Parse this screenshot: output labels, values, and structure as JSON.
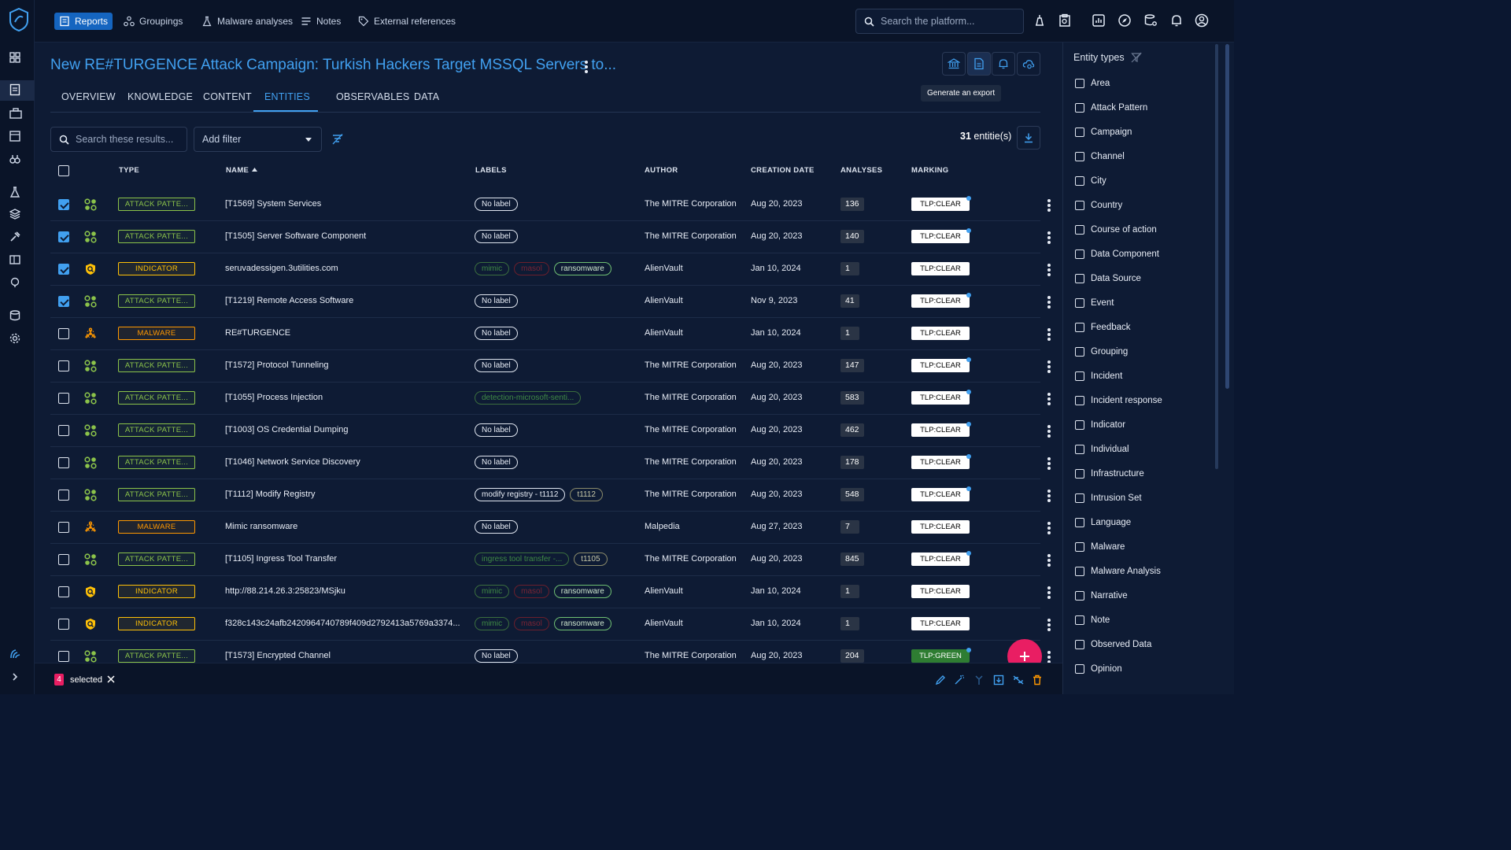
{
  "topnav": {
    "items": [
      {
        "label": "Reports",
        "active": true,
        "icon": "report-icon"
      },
      {
        "label": "Groupings",
        "icon": "groupings-icon"
      },
      {
        "label": "Malware analyses",
        "icon": "malware-analysis-icon"
      },
      {
        "label": "Notes",
        "icon": "notes-icon"
      },
      {
        "label": "External references",
        "icon": "tag-icon"
      }
    ],
    "search_placeholder": "Search the platform..."
  },
  "page": {
    "title": "New RE#TURGENCE Attack Campaign: Turkish Hackers Target MSSQL Servers to...",
    "tooltip": "Generate an export",
    "tabs": [
      "OVERVIEW",
      "KNOWLEDGE",
      "CONTENT",
      "ENTITIES",
      "OBSERVABLES",
      "DATA"
    ],
    "active_tab": "ENTITIES"
  },
  "toolbar": {
    "search_placeholder": "Search these results...",
    "filter_label": "Add filter",
    "count_number": "31",
    "count_suffix": " entitie(s)"
  },
  "table": {
    "headers": {
      "type": "TYPE",
      "name": "NAME",
      "labels": "LABELS",
      "author": "AUTHOR",
      "creation_date": "CREATION DATE",
      "analyses": "ANALYSES",
      "marking": "MARKING"
    },
    "sort": {
      "column": "NAME",
      "direction": "ascending"
    },
    "rows": [
      {
        "checked": true,
        "type": "ATTACK PATTE...",
        "kind": "ap",
        "name": "[T1569] System Services",
        "labels": [
          {
            "text": "No label",
            "style": "nolab"
          }
        ],
        "author": "The MITRE Corporation",
        "date": "Aug 20, 2023",
        "analyses": "136",
        "marking": "TLP:CLEAR",
        "dot": true
      },
      {
        "checked": true,
        "type": "ATTACK PATTE...",
        "kind": "ap",
        "name": "[T1505] Server Software Component",
        "labels": [
          {
            "text": "No label",
            "style": "nolab"
          }
        ],
        "author": "The MITRE Corporation",
        "date": "Aug 20, 2023",
        "analyses": "140",
        "marking": "TLP:CLEAR",
        "dot": true
      },
      {
        "checked": true,
        "type": "INDICATOR",
        "kind": "ind",
        "name": "seruvadessigen.3utilities.com",
        "labels": [
          {
            "text": "mimic",
            "style": "green"
          },
          {
            "text": "masol",
            "style": "red"
          },
          {
            "text": "ransomware",
            "style": "greenb"
          }
        ],
        "author": "AlienVault",
        "date": "Jan 10, 2024",
        "analyses": "1",
        "marking": "TLP:CLEAR",
        "dot": false
      },
      {
        "checked": true,
        "type": "ATTACK PATTE...",
        "kind": "ap",
        "name": "[T1219] Remote Access Software",
        "labels": [
          {
            "text": "No label",
            "style": "nolab"
          }
        ],
        "author": "AlienVault",
        "date": "Nov 9, 2023",
        "analyses": "41",
        "marking": "TLP:CLEAR",
        "dot": true
      },
      {
        "checked": false,
        "type": "MALWARE",
        "kind": "mal",
        "name": "RE#TURGENCE",
        "labels": [
          {
            "text": "No label",
            "style": "nolab"
          }
        ],
        "author": "AlienVault",
        "date": "Jan 10, 2024",
        "analyses": "1",
        "marking": "TLP:CLEAR",
        "dot": false
      },
      {
        "checked": false,
        "type": "ATTACK PATTE...",
        "kind": "ap",
        "name": "[T1572] Protocol Tunneling",
        "labels": [
          {
            "text": "No label",
            "style": "nolab"
          }
        ],
        "author": "The MITRE Corporation",
        "date": "Aug 20, 2023",
        "analyses": "147",
        "marking": "TLP:CLEAR",
        "dot": true
      },
      {
        "checked": false,
        "type": "ATTACK PATTE...",
        "kind": "ap",
        "name": "[T1055] Process Injection",
        "labels": [
          {
            "text": "detection-microsoft-senti...",
            "style": "green"
          }
        ],
        "author": "The MITRE Corporation",
        "date": "Aug 20, 2023",
        "analyses": "583",
        "marking": "TLP:CLEAR",
        "dot": true
      },
      {
        "checked": false,
        "type": "ATTACK PATTE...",
        "kind": "ap",
        "name": "[T1003] OS Credential Dumping",
        "labels": [
          {
            "text": "No label",
            "style": "nolab"
          }
        ],
        "author": "The MITRE Corporation",
        "date": "Aug 20, 2023",
        "analyses": "462",
        "marking": "TLP:CLEAR",
        "dot": true
      },
      {
        "checked": false,
        "type": "ATTACK PATTE...",
        "kind": "ap",
        "name": "[T1046] Network Service Discovery",
        "labels": [
          {
            "text": "No label",
            "style": "nolab"
          }
        ],
        "author": "The MITRE Corporation",
        "date": "Aug 20, 2023",
        "analyses": "178",
        "marking": "TLP:CLEAR",
        "dot": true
      },
      {
        "checked": false,
        "type": "ATTACK PATTE...",
        "kind": "ap",
        "name": "[T1112] Modify Registry",
        "labels": [
          {
            "text": "modify registry - t1112",
            "style": "nolab"
          },
          {
            "text": "t1112",
            "style": "olive"
          }
        ],
        "author": "The MITRE Corporation",
        "date": "Aug 20, 2023",
        "analyses": "548",
        "marking": "TLP:CLEAR",
        "dot": true
      },
      {
        "checked": false,
        "type": "MALWARE",
        "kind": "mal",
        "name": "Mimic ransomware",
        "labels": [
          {
            "text": "No label",
            "style": "nolab"
          }
        ],
        "author": "Malpedia",
        "date": "Aug 27, 2023",
        "analyses": "7",
        "marking": "TLP:CLEAR",
        "dot": false
      },
      {
        "checked": false,
        "type": "ATTACK PATTE...",
        "kind": "ap",
        "name": "[T1105] Ingress Tool Transfer",
        "labels": [
          {
            "text": "ingress tool transfer -...",
            "style": "green"
          },
          {
            "text": "t1105",
            "style": "olive"
          }
        ],
        "author": "The MITRE Corporation",
        "date": "Aug 20, 2023",
        "analyses": "845",
        "marking": "TLP:CLEAR",
        "dot": true
      },
      {
        "checked": false,
        "type": "INDICATOR",
        "kind": "ind",
        "name": "http://88.214.26.3:25823/MSjku",
        "labels": [
          {
            "text": "mimic",
            "style": "green"
          },
          {
            "text": "masol",
            "style": "red"
          },
          {
            "text": "ransomware",
            "style": "greenb"
          }
        ],
        "author": "AlienVault",
        "date": "Jan 10, 2024",
        "analyses": "1",
        "marking": "TLP:CLEAR",
        "dot": false
      },
      {
        "checked": false,
        "type": "INDICATOR",
        "kind": "ind",
        "name": "f328c143c24afb2420964740789f409d2792413a5769a3374...",
        "labels": [
          {
            "text": "mimic",
            "style": "green"
          },
          {
            "text": "masol",
            "style": "red"
          },
          {
            "text": "ransomware",
            "style": "greenb"
          }
        ],
        "author": "AlienVault",
        "date": "Jan 10, 2024",
        "analyses": "1",
        "marking": "TLP:CLEAR",
        "dot": false
      },
      {
        "checked": false,
        "type": "ATTACK PATTE...",
        "kind": "ap",
        "name": "[T1573] Encrypted Channel",
        "labels": [
          {
            "text": "No label",
            "style": "nolab"
          }
        ],
        "author": "The MITRE Corporation",
        "date": "Aug 20, 2023",
        "analyses": "204",
        "marking": "TLP:GREEN",
        "dot": true
      }
    ]
  },
  "bottom_bar": {
    "selected_count": "4",
    "selected_label": "selected"
  },
  "entity_panel": {
    "title": "Entity types",
    "types": [
      "Area",
      "Attack Pattern",
      "Campaign",
      "Channel",
      "City",
      "Country",
      "Course of action",
      "Data Component",
      "Data Source",
      "Event",
      "Feedback",
      "Grouping",
      "Incident",
      "Incident response",
      "Indicator",
      "Individual",
      "Infrastructure",
      "Intrusion Set",
      "Language",
      "Malware",
      "Malware Analysis",
      "Narrative",
      "Note",
      "Observed Data",
      "Opinion"
    ]
  },
  "colors": {
    "accent": "#41a0f0",
    "attack_pattern": "#8bc34a",
    "indicator": "#ffc107",
    "malware": "#ff9800",
    "fab": "#e91e63"
  }
}
